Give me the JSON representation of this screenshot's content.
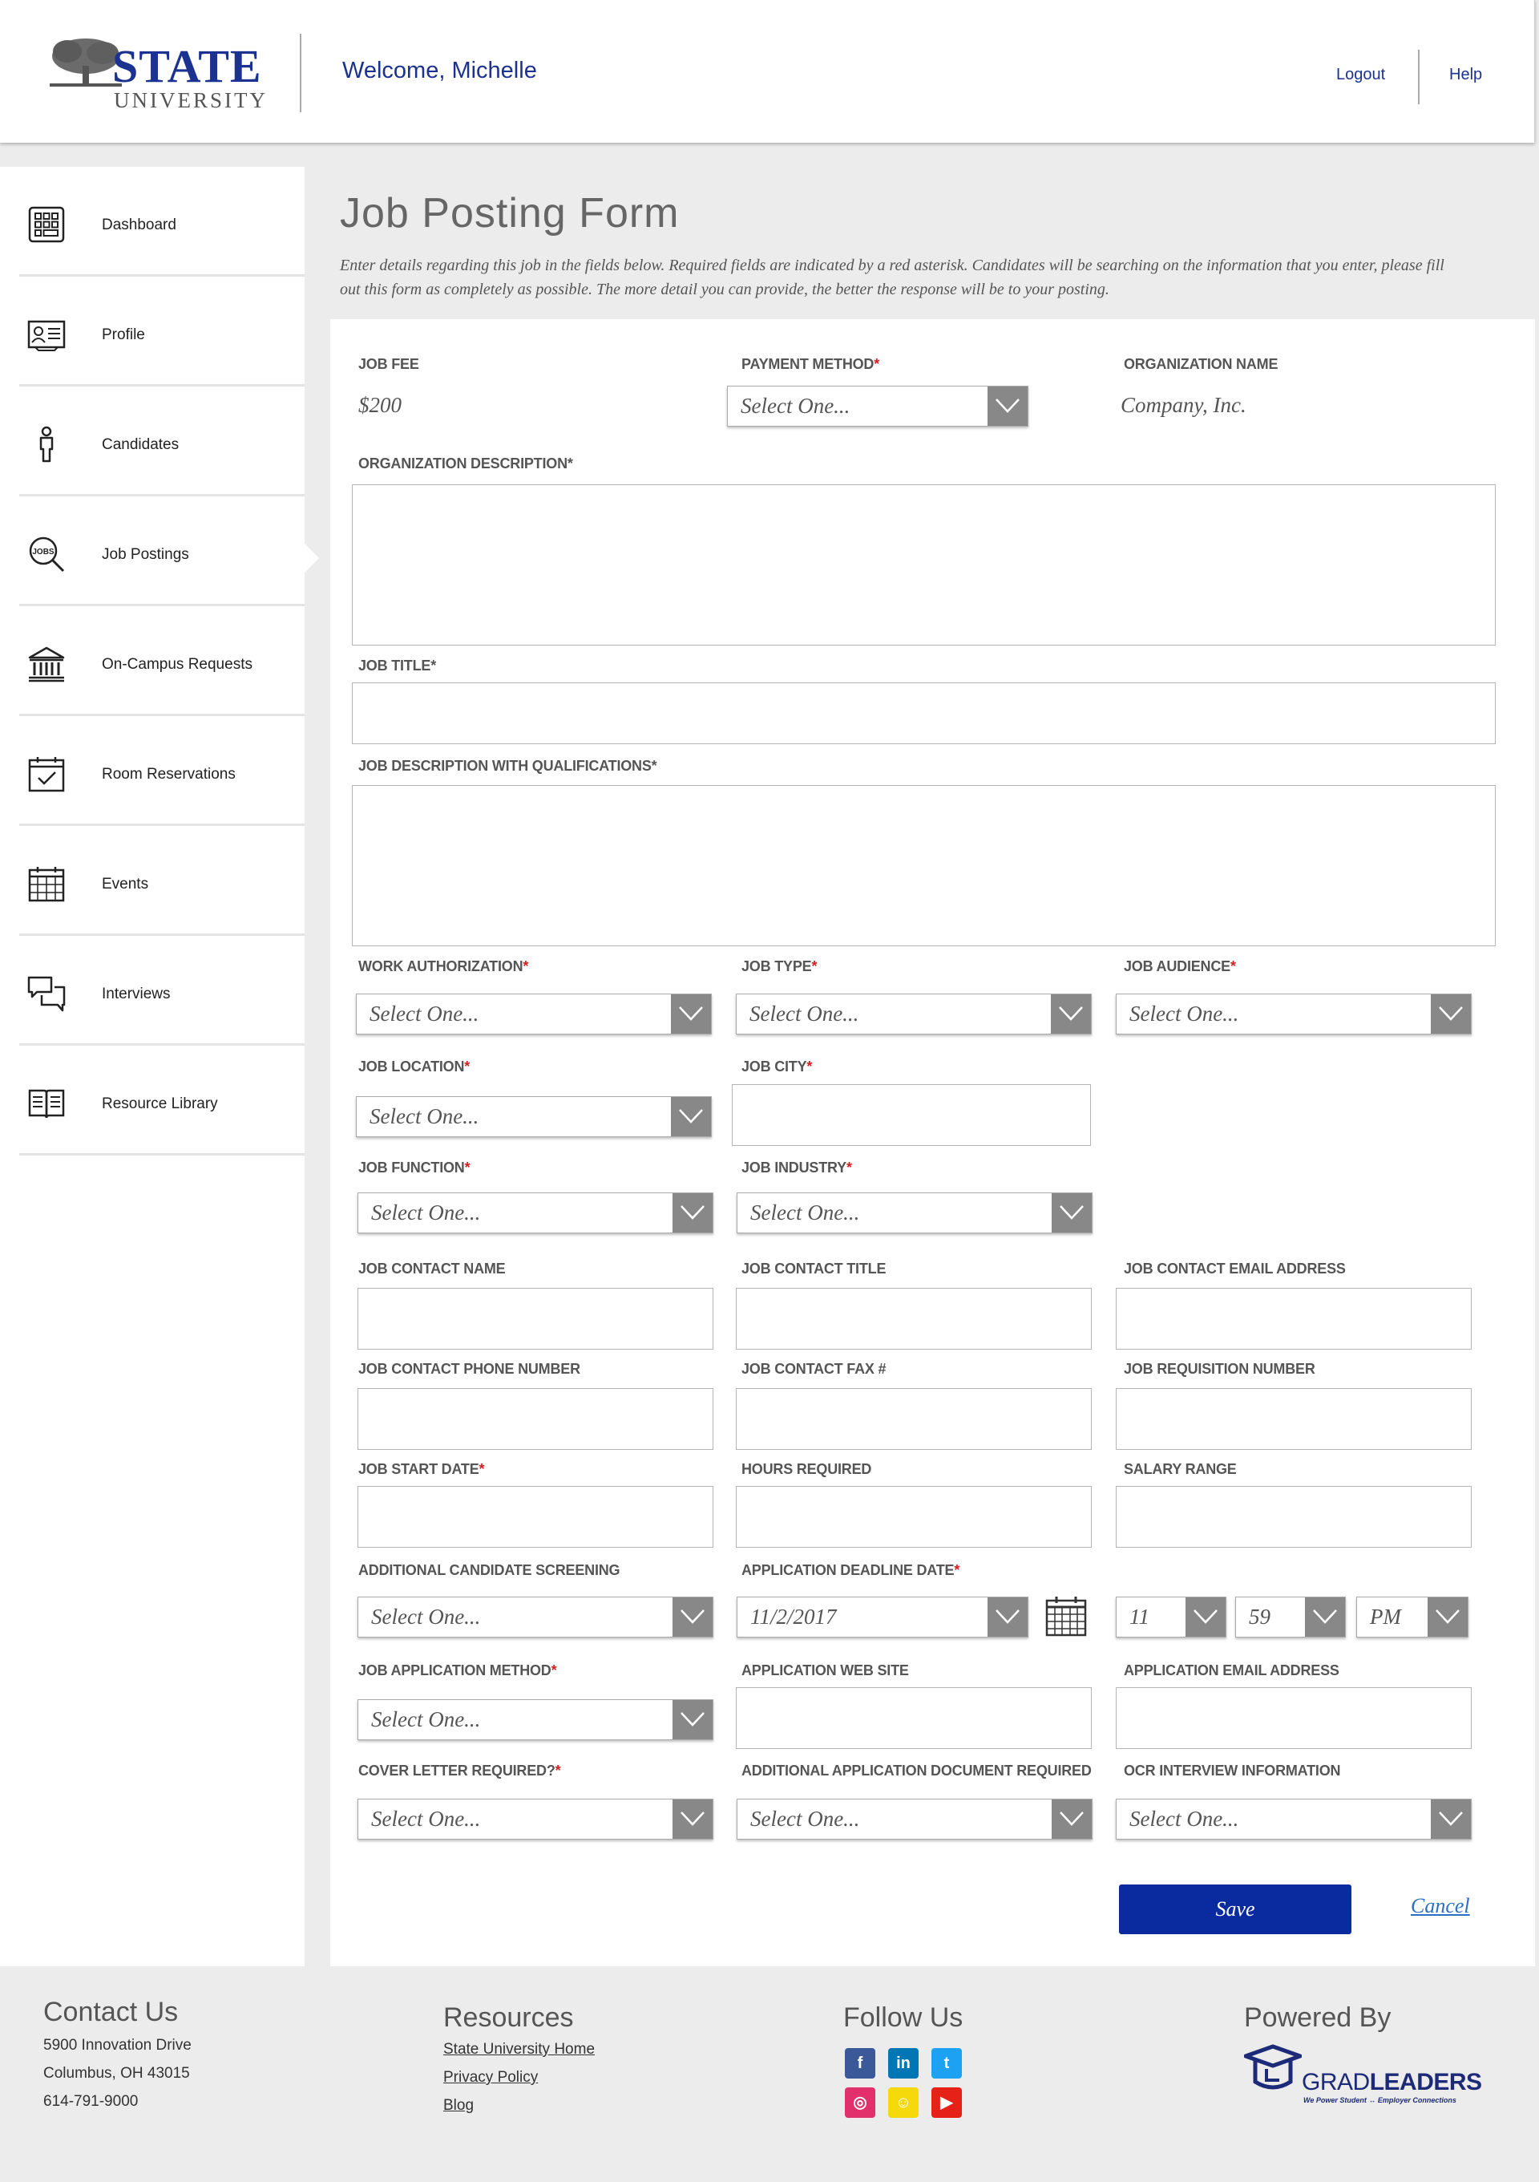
{
  "header": {
    "logo_top": "STATE",
    "logo_bottom": "UNIVERSITY",
    "welcome": "Welcome, Michelle",
    "logout": "Logout",
    "help": "Help"
  },
  "sidebar": {
    "items": [
      {
        "label": "Dashboard",
        "icon": "dashboard-grid-icon"
      },
      {
        "label": "Profile",
        "icon": "id-card-icon"
      },
      {
        "label": "Candidates",
        "icon": "person-icon"
      },
      {
        "label": "Job Postings",
        "icon": "jobs-magnifier-icon",
        "active": true
      },
      {
        "label": "On-Campus Requests",
        "icon": "building-icon"
      },
      {
        "label": "Room Reservations",
        "icon": "calendar-check-icon"
      },
      {
        "label": "Events",
        "icon": "calendar-icon"
      },
      {
        "label": "Interviews",
        "icon": "chat-bubbles-icon"
      },
      {
        "label": "Resource Library",
        "icon": "book-icon"
      }
    ]
  },
  "page": {
    "title": "Job Posting Form",
    "intro": "Enter details regarding this job in the fields below. Required fields are indicated by a red asterisk. Candidates will be searching on the information that you enter, please fill out this form as completely as possible. The more detail you can provide, the better the response will be to your posting."
  },
  "form": {
    "job_fee": {
      "label": "JOB FEE",
      "value": "$200"
    },
    "payment_method": {
      "label": "PAYMENT METHOD",
      "value": "Select One..."
    },
    "organization_name": {
      "label": "ORGANIZATION NAME",
      "value": "Company, Inc."
    },
    "organization_description": {
      "label": "ORGANIZATION DESCRIPTION"
    },
    "job_title": {
      "label": "JOB TITLE"
    },
    "job_description": {
      "label": "JOB DESCRIPTION WITH QUALIFICATIONS"
    },
    "work_authorization": {
      "label": "WORK AUTHORIZATION",
      "value": "Select One..."
    },
    "job_type": {
      "label": "JOB TYPE",
      "value": "Select One..."
    },
    "job_audience": {
      "label": "JOB AUDIENCE",
      "value": "Select One..."
    },
    "job_location": {
      "label": "JOB LOCATION",
      "value": "Select One..."
    },
    "job_city": {
      "label": "JOB CITY"
    },
    "job_function": {
      "label": "JOB FUNCTION",
      "value": "Select One..."
    },
    "job_industry": {
      "label": "JOB INDUSTRY",
      "value": "Select One..."
    },
    "job_contact_name": {
      "label": "JOB CONTACT NAME"
    },
    "job_contact_title": {
      "label": "JOB CONTACT TITLE"
    },
    "job_contact_email": {
      "label": "JOB CONTACT EMAIL ADDRESS"
    },
    "job_contact_phone": {
      "label": "JOB CONTACT PHONE NUMBER"
    },
    "job_contact_fax": {
      "label": "JOB CONTACT FAX #"
    },
    "job_requisition_number": {
      "label": "JOB REQUISITION NUMBER"
    },
    "job_start_date": {
      "label": "JOB START DATE"
    },
    "hours_required": {
      "label": "HOURS REQUIRED"
    },
    "salary_range": {
      "label": "SALARY RANGE"
    },
    "additional_screening": {
      "label": "ADDITIONAL CANDIDATE SCREENING",
      "value": "Select One..."
    },
    "application_deadline": {
      "label": "APPLICATION DEADLINE DATE",
      "date": "11/2/2017",
      "hour": "11",
      "minute": "59",
      "ampm": "PM"
    },
    "application_method": {
      "label": "JOB APPLICATION METHOD",
      "value": "Select One..."
    },
    "application_web_site": {
      "label": "APPLICATION WEB SITE"
    },
    "application_email": {
      "label": "APPLICATION EMAIL ADDRESS"
    },
    "cover_letter_required": {
      "label": "COVER LETTER REQUIRED?",
      "value": "Select One..."
    },
    "additional_document": {
      "label": "ADDITIONAL APPLICATION DOCUMENT REQUIRED",
      "value": "Select One..."
    },
    "ocr_interview": {
      "label": "OCR INTERVIEW INFORMATION",
      "value": "Select One..."
    },
    "save": "Save",
    "cancel": "Cancel"
  },
  "footer": {
    "contact": {
      "heading": "Contact Us",
      "address1": "5900 Innovation Drive",
      "address2": "Columbus, OH 43015",
      "phone": "614-791-9000"
    },
    "resources": {
      "heading": "Resources",
      "links": [
        "State University Home",
        "Privacy Policy",
        "Blog"
      ]
    },
    "follow": {
      "heading": "Follow Us",
      "networks": [
        {
          "name": "facebook-icon",
          "glyph": "f",
          "color": "#3b5998"
        },
        {
          "name": "linkedin-icon",
          "glyph": "in",
          "color": "#0077b5"
        },
        {
          "name": "twitter-icon",
          "glyph": "t",
          "color": "#1da1f2"
        },
        {
          "name": "instagram-icon",
          "glyph": "◎",
          "color": "#e1306c"
        },
        {
          "name": "snapchat-icon",
          "glyph": "☺",
          "color": "#f5d90a"
        },
        {
          "name": "youtube-icon",
          "glyph": "▶",
          "color": "#e62117"
        }
      ]
    },
    "powered": {
      "heading": "Powered By",
      "brand_light": "GRAD",
      "brand_bold": "LEADERS",
      "tagline": "We Power Student ↔ Employer Connections"
    }
  },
  "colors": {
    "brand": "#1c3290",
    "save_button": "#0a2ba0",
    "required": "#d42020",
    "link": "#2a6fc4"
  }
}
